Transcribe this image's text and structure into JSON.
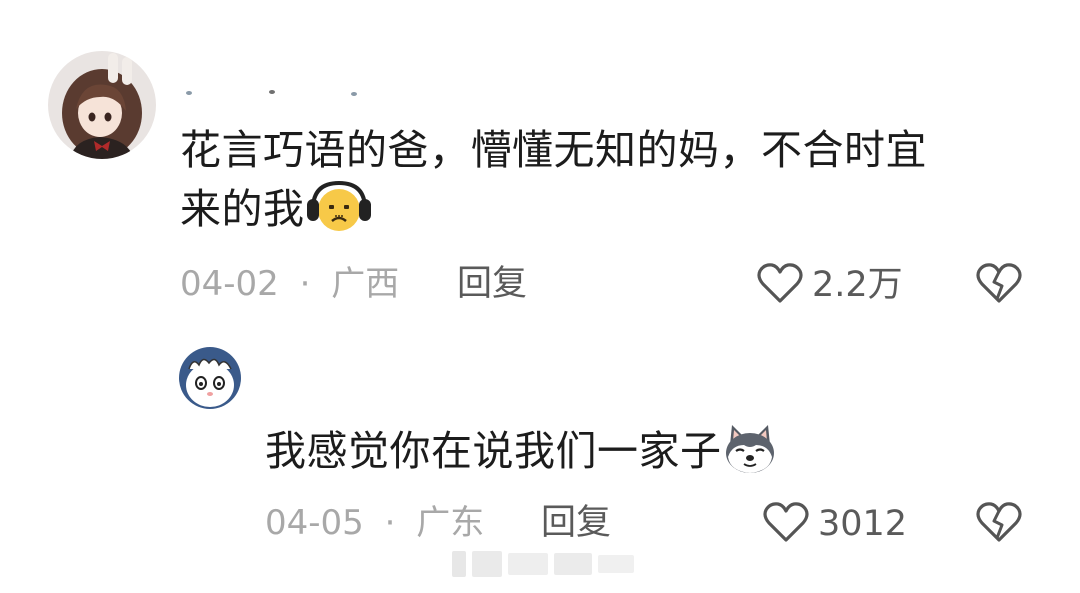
{
  "comments": [
    {
      "username": "",
      "text_line1": "花言巧语的爸，懵懂无知的妈，不合时宜",
      "text_line2": "来的我",
      "emoji": "headphones-face-emoji",
      "date": "04-02",
      "separator": "·",
      "location": "广西",
      "reply_label": "回复",
      "like_count": "2.2万"
    },
    {
      "text": "我感觉你在说我们一家子",
      "emoji": "husky-dog-emoji",
      "date": "04-05",
      "separator": "·",
      "location": "广东",
      "reply_label": "回复",
      "like_count": "3012"
    }
  ],
  "icons": {
    "like": "heart-outline-icon",
    "dislike": "broken-heart-icon"
  },
  "colors": {
    "text_primary": "#1c1c1c",
    "meta_gray": "#a8a8a8",
    "action_gray": "#5a5a5a",
    "emoji_yellow": "#f7c948"
  }
}
